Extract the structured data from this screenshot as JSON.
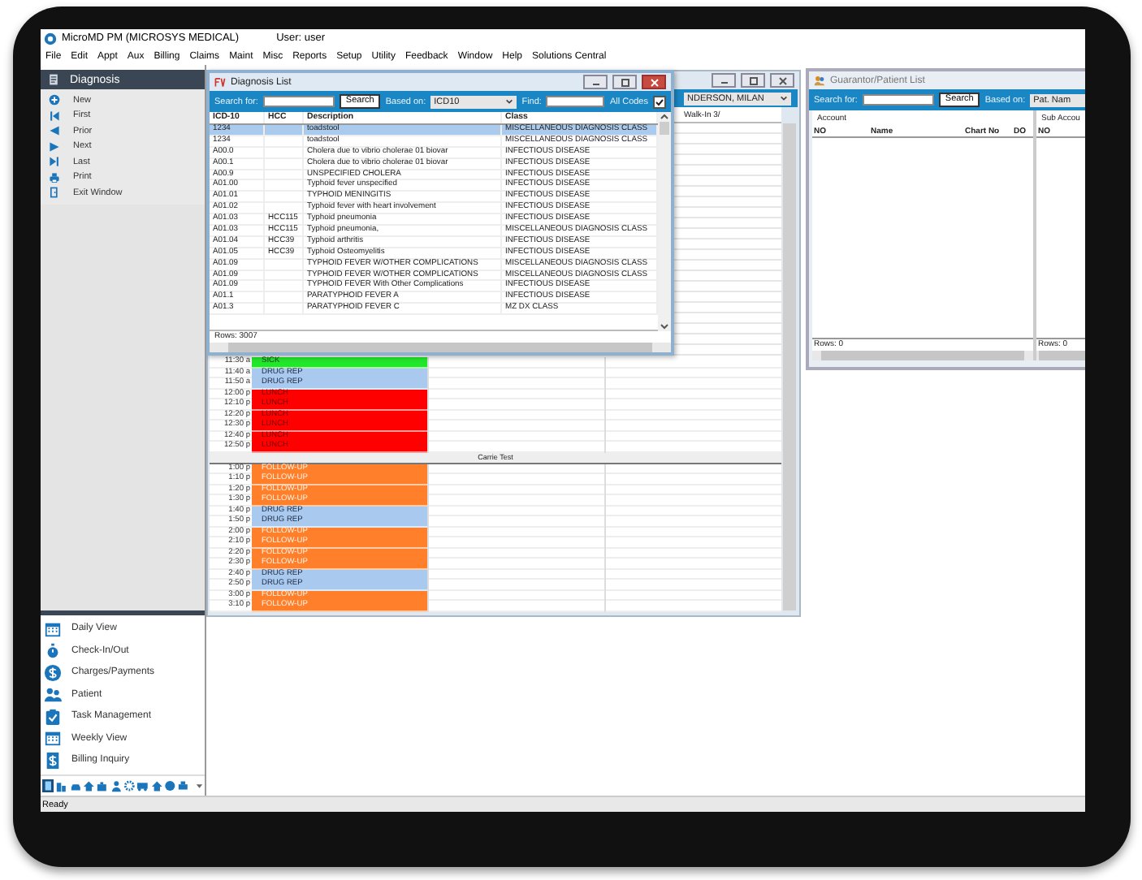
{
  "app": {
    "title": "MicroMD PM (MICROSYS MEDICAL)",
    "user": "User: user"
  },
  "menu": [
    "File",
    "Edit",
    "Appt",
    "Aux",
    "Billing",
    "Claims",
    "Maint",
    "Misc",
    "Reports",
    "Setup",
    "Utility",
    "Feedback",
    "Window",
    "Help",
    "Solutions Central"
  ],
  "sidebar": {
    "header": "Diagnosis",
    "actions": [
      {
        "label": "New",
        "kind": "new"
      },
      {
        "label": "First",
        "kind": "first"
      },
      {
        "label": "Prior",
        "kind": "prior"
      },
      {
        "label": "Next",
        "kind": "next"
      },
      {
        "label": "Last",
        "kind": "last"
      },
      {
        "label": "Print",
        "kind": "print"
      },
      {
        "label": "Exit Window",
        "kind": "exit"
      }
    ]
  },
  "navigation": [
    {
      "label": "Daily View",
      "kind": "calendar"
    },
    {
      "label": "Check-In/Out",
      "kind": "stopwatch"
    },
    {
      "label": "Charges/Payments",
      "kind": "dollar"
    },
    {
      "label": "Patient",
      "kind": "people"
    },
    {
      "label": "Task Management",
      "kind": "clipboard"
    },
    {
      "label": "Weekly View",
      "kind": "calendar"
    },
    {
      "label": "Billing Inquiry",
      "kind": "bill"
    }
  ],
  "diagnosis_window": {
    "title": "Diagnosis List",
    "search_label": "Search for:",
    "search_button": "Search",
    "based_on_label": "Based on:",
    "based_on_value": "ICD10",
    "find_label": "Find:",
    "all_codes_label": "All Codes",
    "all_codes_checked": true,
    "columns": [
      "ICD-10",
      "HCC",
      "Description",
      "Class"
    ],
    "rows": [
      {
        "cells": [
          "1234",
          "",
          "toadstool",
          "MISCELLANEOUS DIAGNOSIS CLASS"
        ],
        "selected": true
      },
      {
        "cells": [
          "1234",
          "",
          "toadstool",
          "MISCELLANEOUS DIAGNOSIS CLASS"
        ],
        "selected": false
      },
      {
        "cells": [
          "A00.0",
          "",
          "Cholera due to vibrio cholerae 01 biovar",
          "INFECTIOUS DISEASE"
        ],
        "selected": false
      },
      {
        "cells": [
          "A00.1",
          "",
          "Cholera due to vibrio cholerae 01 biovar",
          "INFECTIOUS DISEASE"
        ],
        "selected": false
      },
      {
        "cells": [
          "A00.9",
          "",
          "UNSPECIFIED CHOLERA",
          "INFECTIOUS DISEASE"
        ],
        "selected": false
      },
      {
        "cells": [
          "A01.00",
          "",
          "Typhoid fever unspecified",
          "INFECTIOUS DISEASE"
        ],
        "selected": false
      },
      {
        "cells": [
          "A01.01",
          "",
          "TYPHOID MENINGITIS",
          "INFECTIOUS DISEASE"
        ],
        "selected": false
      },
      {
        "cells": [
          "A01.02",
          "",
          "Typhoid fever with heart involvement",
          "INFECTIOUS DISEASE"
        ],
        "selected": false
      },
      {
        "cells": [
          "A01.03",
          "HCC115",
          "Typhoid pneumonia",
          "INFECTIOUS DISEASE"
        ],
        "selected": false
      },
      {
        "cells": [
          "A01.03",
          "HCC115",
          "Typhoid pneumonia,",
          "MISCELLANEOUS DIAGNOSIS CLASS"
        ],
        "selected": false
      },
      {
        "cells": [
          "A01.04",
          "HCC39",
          "Typhoid arthritis",
          "INFECTIOUS DISEASE"
        ],
        "selected": false
      },
      {
        "cells": [
          "A01.05",
          "HCC39",
          "Typhoid Osteomyelitis",
          "INFECTIOUS DISEASE"
        ],
        "selected": false
      },
      {
        "cells": [
          "A01.09",
          "",
          "TYPHOID FEVER W/OTHER COMPLICATIONS",
          "MISCELLANEOUS DIAGNOSIS CLASS"
        ],
        "selected": false
      },
      {
        "cells": [
          "A01.09",
          "",
          "TYPHOID FEVER W/OTHER COMPLICATIONS",
          "MISCELLANEOUS DIAGNOSIS CLASS"
        ],
        "selected": false
      },
      {
        "cells": [
          "A01.09",
          "",
          "TYPHOID FEVER With Other Complications",
          "INFECTIOUS DISEASE"
        ],
        "selected": false
      },
      {
        "cells": [
          "A01.1",
          "",
          "PARATYPHOID FEVER A",
          "INFECTIOUS DISEASE"
        ],
        "selected": false
      },
      {
        "cells": [
          "A01.3",
          "",
          "PARATYPHOID FEVER C",
          "MZ DX CLASS"
        ],
        "selected": false
      }
    ],
    "rows_count": "Rows: 3007"
  },
  "schedule": {
    "provider": "NDERSON, MILAN",
    "column_header": "Walk-In 3/",
    "blocks": [
      {
        "rows": [
          {
            "time": "11:30 a",
            "label": "SICK",
            "kind": "sick",
            "color": "#22e62a"
          },
          {
            "time": "11:40 a",
            "label": "DRUG REP",
            "kind": "drug-rep",
            "color": "#a9c9ee"
          },
          {
            "time": "11:50 a",
            "label": "DRUG REP",
            "kind": "drug-rep",
            "color": "#a9c9ee"
          },
          {
            "time": "12:00 p",
            "label": "LUNCH",
            "kind": "lunch",
            "color": "#ff0000"
          },
          {
            "time": "12:10 p",
            "label": "LUNCH",
            "kind": "lunch",
            "color": "#ff0000"
          },
          {
            "time": "12:20 p",
            "label": "LUNCH",
            "kind": "lunch",
            "color": "#ff0000"
          },
          {
            "time": "12:30 p",
            "label": "LUNCH",
            "kind": "lunch",
            "color": "#ff0000"
          },
          {
            "time": "12:40 p",
            "label": "LUNCH",
            "kind": "lunch",
            "color": "#ff0000"
          },
          {
            "time": "12:50 p",
            "label": "LUNCH",
            "kind": "lunch",
            "color": "#ff0000"
          }
        ]
      },
      {
        "title": "Carrie Test",
        "rows": [
          {
            "time": "1:00 p",
            "label": "FOLLOW-UP",
            "kind": "follow-up",
            "color": "#ff7f2a"
          },
          {
            "time": "1:10 p",
            "label": "FOLLOW-UP",
            "kind": "follow-up",
            "color": "#ff7f2a"
          },
          {
            "time": "1:20 p",
            "label": "FOLLOW-UP",
            "kind": "follow-up",
            "color": "#ff7f2a"
          },
          {
            "time": "1:30 p",
            "label": "FOLLOW-UP",
            "kind": "follow-up",
            "color": "#ff7f2a"
          },
          {
            "time": "1:40 p",
            "label": "DRUG REP",
            "kind": "drug-rep",
            "color": "#a9c9ee"
          },
          {
            "time": "1:50 p",
            "label": "DRUG REP",
            "kind": "drug-rep",
            "color": "#a9c9ee"
          },
          {
            "time": "2:00 p",
            "label": "FOLLOW-UP",
            "kind": "follow-up",
            "color": "#ff7f2a"
          },
          {
            "time": "2:10 p",
            "label": "FOLLOW-UP",
            "kind": "follow-up",
            "color": "#ff7f2a"
          },
          {
            "time": "2:20 p",
            "label": "FOLLOW-UP",
            "kind": "follow-up",
            "color": "#ff7f2a"
          },
          {
            "time": "2:30 p",
            "label": "FOLLOW-UP",
            "kind": "follow-up",
            "color": "#ff7f2a"
          },
          {
            "time": "2:40 p",
            "label": "DRUG REP",
            "kind": "drug-rep",
            "color": "#a9c9ee"
          },
          {
            "time": "2:50 p",
            "label": "DRUG REP",
            "kind": "drug-rep",
            "color": "#a9c9ee"
          },
          {
            "time": "3:00 p",
            "label": "FOLLOW-UP",
            "kind": "follow-up",
            "color": "#ff7f2a"
          },
          {
            "time": "3:10 p",
            "label": "FOLLOW-UP",
            "kind": "follow-up",
            "color": "#ff7f2a"
          }
        ]
      }
    ]
  },
  "guarantor_window": {
    "title": "Guarantor/Patient List",
    "search_label": "Search for:",
    "search_button": "Search",
    "based_on_label": "Based on:",
    "based_on_value": "Pat. Nam",
    "account_group": "Account",
    "columns": [
      "NO",
      "Name",
      "Chart No",
      "DO"
    ],
    "sub_group": "Sub Accou",
    "sub_columns": [
      "NO"
    ],
    "rows_count": "Rows: 0",
    "sub_rows_count": "Rows: 0"
  },
  "status_bar": "Ready"
}
